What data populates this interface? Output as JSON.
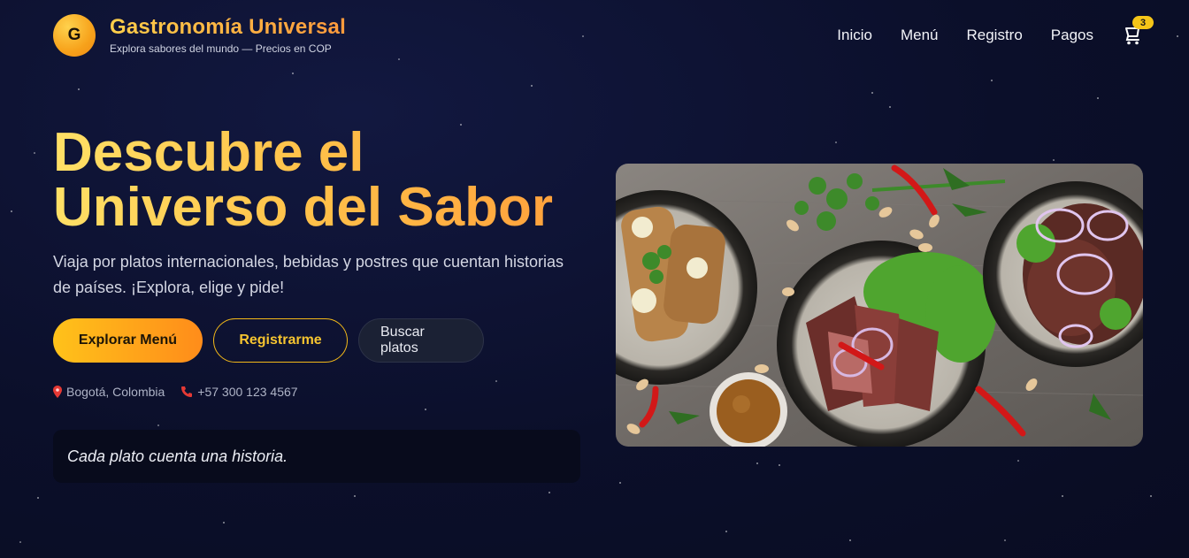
{
  "header": {
    "logo_letter": "G",
    "title": "Gastronomía Universal",
    "subtitle": "Explora sabores del mundo — Precios en COP",
    "nav": [
      {
        "label": "Inicio"
      },
      {
        "label": "Menú"
      },
      {
        "label": "Registro"
      },
      {
        "label": "Pagos"
      }
    ],
    "cart_icon": "cart-icon",
    "cart_count": "3"
  },
  "hero": {
    "title_line1": "Descubre el",
    "title_line2": "Universo del Sabor",
    "description": "Viaja por platos internacionales, bebidas y postres que cuentan historias de países. ¡Explora, elige y pide!",
    "buttons": {
      "explore": "Explorar Menú",
      "register": "Registrarme",
      "search": "Buscar platos"
    },
    "location_icon": "pin-icon",
    "location": "Bogotá, Colombia",
    "phone_icon": "phone-icon",
    "phone": "+57 300 123 4567",
    "quote": "Cada plato cuenta una historia."
  },
  "colors": {
    "background": "#0b0f2a",
    "accent_yellow": "#ffc21a",
    "accent_orange": "#ff8c1a",
    "outline_gold": "#f2b818"
  }
}
